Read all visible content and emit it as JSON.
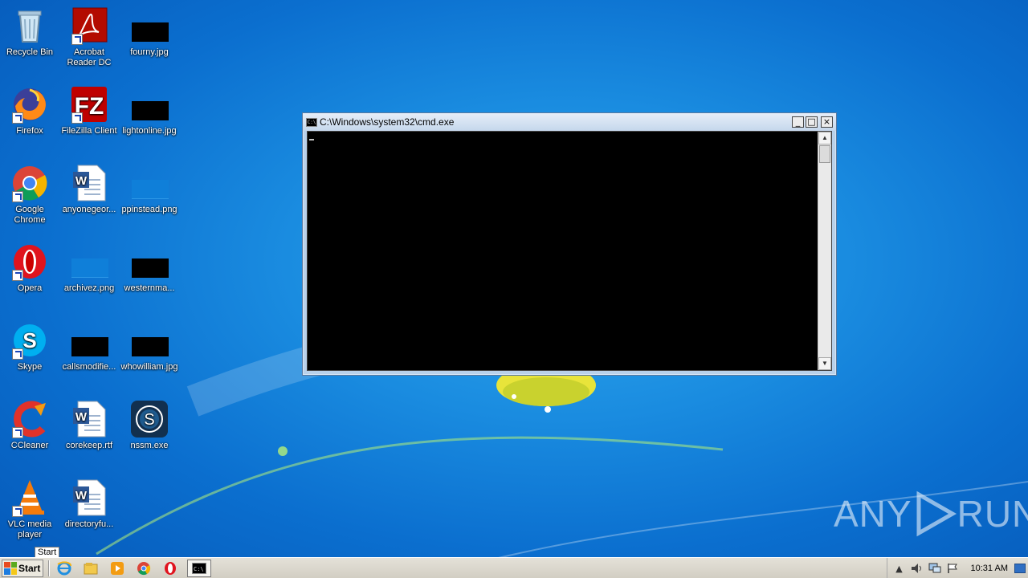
{
  "desktop_icons": [
    {
      "label": "Recycle Bin"
    },
    {
      "label": "Acrobat Reader DC"
    },
    {
      "label": "fourny.jpg"
    },
    {
      "label": "Firefox"
    },
    {
      "label": "FileZilla Client"
    },
    {
      "label": "lightonline.jpg"
    },
    {
      "label": "Google Chrome"
    },
    {
      "label": "anyonegeor..."
    },
    {
      "label": "ppinstead.png"
    },
    {
      "label": "Opera"
    },
    {
      "label": "archivez.png"
    },
    {
      "label": "westernma..."
    },
    {
      "label": "Skype"
    },
    {
      "label": "callsmodifie..."
    },
    {
      "label": "whowilliam.jpg"
    },
    {
      "label": "CCleaner"
    },
    {
      "label": "corekeep.rtf"
    },
    {
      "label": "nssm.exe"
    },
    {
      "label": "VLC media player"
    },
    {
      "label": "directoryfu..."
    }
  ],
  "cmd_window": {
    "title": "C:\\Windows\\system32\\cmd.exe",
    "icon_text": "C:\\"
  },
  "taskbar": {
    "start_label": "Start",
    "tooltip": "Start",
    "clock": "10:31 AM"
  },
  "watermark": {
    "left": "ANY",
    "right": "RUN"
  },
  "colors": {
    "desktop": "#1a8ce0",
    "cmd_background": "#000000",
    "taskbar": "#d9d6cc"
  }
}
